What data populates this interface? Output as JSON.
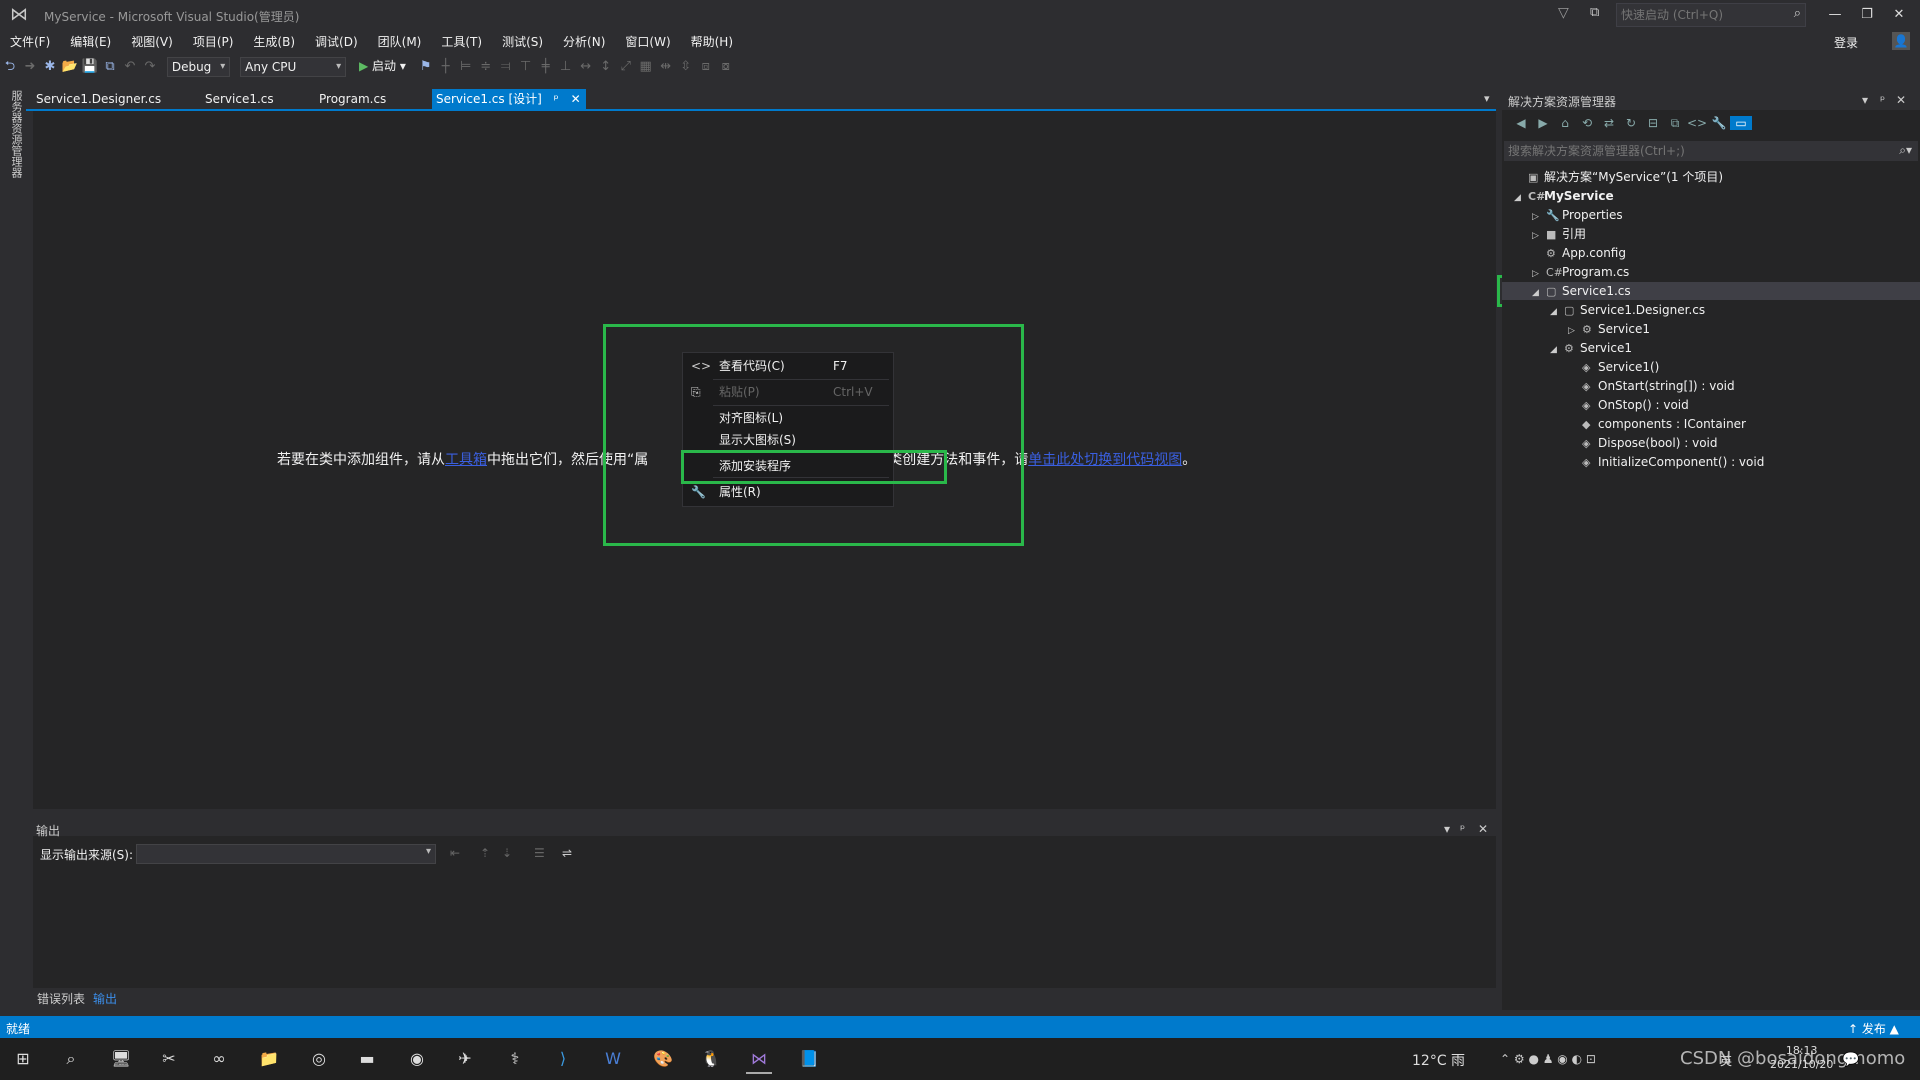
{
  "window": {
    "title": "MyService - Microsoft Visual Studio(管理员)",
    "quick_launch_placeholder": "快速启动 (Ctrl+Q)"
  },
  "menu": [
    "文件(F)",
    "编辑(E)",
    "视图(V)",
    "项目(P)",
    "生成(B)",
    "调试(D)",
    "团队(M)",
    "工具(T)",
    "测试(S)",
    "分析(N)",
    "窗口(W)",
    "帮助(H)"
  ],
  "account": {
    "login": "登录"
  },
  "toolbar": {
    "config": "Debug",
    "platform": "Any CPU",
    "start": "启动"
  },
  "left_strip": {
    "toolbox": "服务器资源管理器"
  },
  "tabs": [
    {
      "label": "Service1.Designer.cs"
    },
    {
      "label": "Service1.cs"
    },
    {
      "label": "Program.cs"
    },
    {
      "label": "Service1.cs [设计]",
      "pin": "ᵖ",
      "close": "✕"
    }
  ],
  "designer": {
    "hint_1": "若要在类中添加组件，请从",
    "hint_link1": "工具箱",
    "hint_2": "中拖出它们，然后使用“属",
    "hint_3": "要为类创建方法和事件，请",
    "hint_link2": "单击此处切换到代码视图",
    "hint_end": "。"
  },
  "context_menu": [
    {
      "label": "查看代码(C)",
      "shortcut": "F7",
      "icon": "<>",
      "enabled": true
    },
    {
      "label": "粘贴(P)",
      "shortcut": "Ctrl+V",
      "icon": "⎘",
      "enabled": false
    },
    {
      "label": "对齐图标(L)",
      "shortcut": "",
      "icon": "",
      "enabled": true
    },
    {
      "label": "显示大图标(S)",
      "shortcut": "",
      "icon": "",
      "enabled": true
    },
    {
      "label": "添加安装程序",
      "shortcut": "",
      "icon": "",
      "enabled": true
    },
    {
      "label": "属性(R)",
      "shortcut": "",
      "icon": "🔧",
      "enabled": true
    }
  ],
  "output": {
    "title": "输出",
    "source_label": "显示输出来源(S):",
    "source_value": ""
  },
  "bottom_tabs": [
    "错误列表",
    "输出"
  ],
  "solution_explorer": {
    "title": "解决方案资源管理器",
    "search_placeholder": "搜索解决方案资源管理器(Ctrl+;)",
    "tree": [
      {
        "label": "解决方案“MyService”(1 个项目)",
        "level": 0,
        "arrow": "",
        "icon": "▣",
        "bold": false
      },
      {
        "label": "MyService",
        "level": 0,
        "arrow": "◢",
        "icon": "C#",
        "bold": true
      },
      {
        "label": "Properties",
        "level": 1,
        "arrow": "▷",
        "icon": "🔧",
        "bold": false
      },
      {
        "label": "引用",
        "level": 1,
        "arrow": "▷",
        "icon": "■",
        "bold": false
      },
      {
        "label": "App.config",
        "level": 1,
        "arrow": "",
        "icon": "⚙",
        "bold": false
      },
      {
        "label": "Program.cs",
        "level": 1,
        "arrow": "▷",
        "icon": "C#",
        "bold": false
      },
      {
        "label": "Service1.cs",
        "level": 1,
        "arrow": "◢",
        "icon": "▢",
        "bold": false,
        "selected": true
      },
      {
        "label": "Service1.Designer.cs",
        "level": 2,
        "arrow": "◢",
        "icon": "▢",
        "bold": false
      },
      {
        "label": "Service1",
        "level": 3,
        "arrow": "▷",
        "icon": "⚙",
        "bold": false
      },
      {
        "label": "Service1",
        "level": 2,
        "arrow": "◢",
        "icon": "⚙",
        "bold": false
      },
      {
        "label": "Service1()",
        "level": 3,
        "arrow": "",
        "icon": "◈",
        "bold": false
      },
      {
        "label": "OnStart(string[]) : void",
        "level": 3,
        "arrow": "",
        "icon": "◈",
        "bold": false
      },
      {
        "label": "OnStop() : void",
        "level": 3,
        "arrow": "",
        "icon": "◈",
        "bold": false
      },
      {
        "label": "components : IContainer",
        "level": 3,
        "arrow": "",
        "icon": "◆",
        "bold": false
      },
      {
        "label": "Dispose(bool) : void",
        "level": 3,
        "arrow": "",
        "icon": "◈",
        "bold": false
      },
      {
        "label": "InitializeComponent() : void",
        "level": 3,
        "arrow": "",
        "icon": "◈",
        "bold": false
      }
    ]
  },
  "status": {
    "text": "就绪",
    "publish": "↑ 发布 ▲"
  },
  "tray": {
    "weather": "12°C 雨",
    "lang": "英",
    "time": "18:13",
    "date": "2021/10/20",
    "watermark": "CSDN @bosaidongmomo"
  },
  "colors": {
    "accent": "#007acc",
    "highlight_green": "#2ab84a",
    "highlight_red": "#e5202e"
  }
}
